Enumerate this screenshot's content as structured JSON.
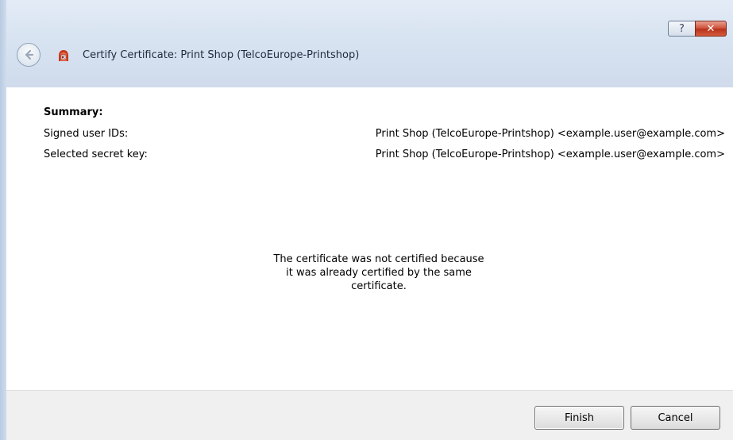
{
  "window": {
    "title": "Certify Certificate: Print Shop (TelcoEurope-Printshop)",
    "help_label": "?",
    "close_label": "✕"
  },
  "summary": {
    "heading": "Summary:",
    "rows": [
      {
        "label": "Signed user IDs:",
        "value": "Print Shop (TelcoEurope-Printshop) <example.user@example.com>"
      },
      {
        "label": "Selected secret key:",
        "value": "Print Shop (TelcoEurope-Printshop) <example.user@example.com>"
      }
    ]
  },
  "message": {
    "line1": "The certificate was not certified because",
    "line2": "it was already certified by the same",
    "line3": "certificate."
  },
  "footer": {
    "finish_label": "Finish",
    "cancel_label": "Cancel"
  },
  "colors": {
    "accent": "#d0573f",
    "titlebar": "#d9e4f2",
    "footer": "#f0f0f0"
  },
  "icons": {
    "back": "back-arrow-icon",
    "app": "kleopatra-certificate-icon",
    "help": "help-icon",
    "close": "close-icon"
  }
}
